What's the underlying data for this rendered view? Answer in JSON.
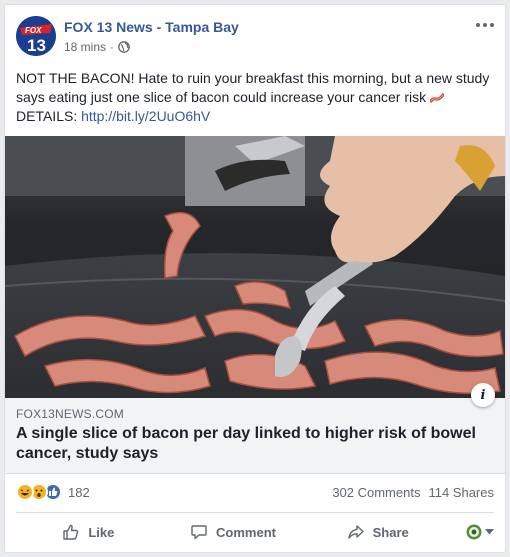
{
  "post": {
    "page_name": "FOX 13 News - Tampa Bay",
    "time": "18 mins",
    "privacy_icon": "globe-icon",
    "avatar_text": "FOX 13",
    "text_main": "NOT THE BACON! Hate to ruin your breakfast this morning, but a new study says eating just one slice of bacon could increase your cancer risk",
    "text_emoji": "bacon-emoji",
    "details_label": "DETAILS:",
    "details_link": "http://bit.ly/2UuO6hV"
  },
  "link_preview": {
    "domain": "FOX13NEWS.COM",
    "headline": "A single slice of bacon per day linked to higher risk of bowel cancer, study says",
    "info_icon": "i"
  },
  "engagement": {
    "reaction_icons": [
      "haha-reaction-icon",
      "wow-reaction-icon",
      "like-reaction-icon"
    ],
    "reaction_count": "182",
    "comments": "302 Comments",
    "shares": "114 Shares"
  },
  "actions": {
    "like": "Like",
    "comment": "Comment",
    "share": "Share"
  },
  "colors": {
    "link": "#365899",
    "like_blue": "#4267b2",
    "haha_yellow": "#f7b125"
  }
}
